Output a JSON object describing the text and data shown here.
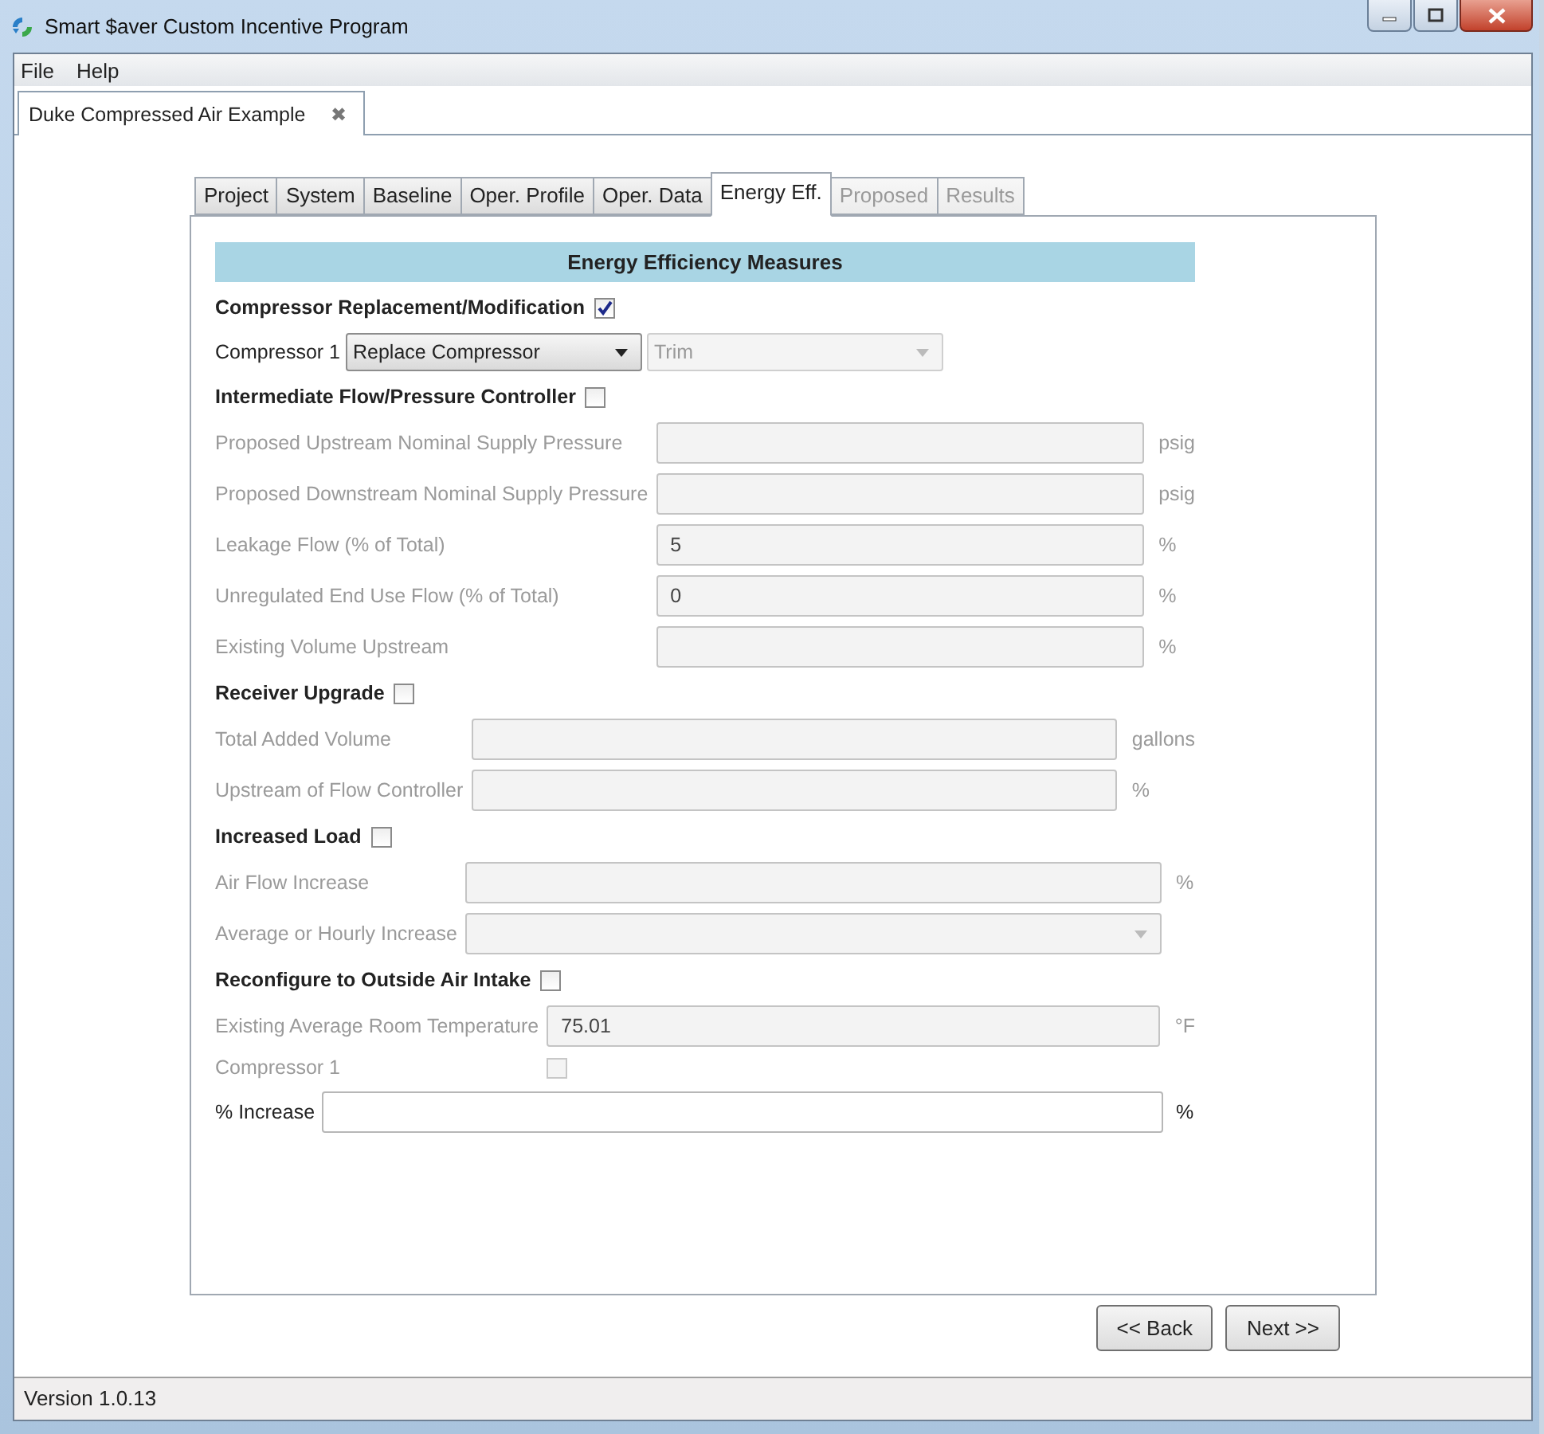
{
  "window": {
    "title": "Smart $aver Custom Incentive Program"
  },
  "menu": [
    "File",
    "Help"
  ],
  "document_tab": {
    "label": "Duke Compressed Air Example",
    "close": "✖"
  },
  "tabs": [
    {
      "label": "Project",
      "selected": false,
      "disabled": false
    },
    {
      "label": "System",
      "selected": false,
      "disabled": false
    },
    {
      "label": "Baseline",
      "selected": false,
      "disabled": false
    },
    {
      "label": "Oper. Profile",
      "selected": false,
      "disabled": false
    },
    {
      "label": "Oper. Data",
      "selected": false,
      "disabled": false
    },
    {
      "label": "Energy Eff.",
      "selected": true,
      "disabled": false
    },
    {
      "label": "Proposed",
      "selected": false,
      "disabled": true
    },
    {
      "label": "Results",
      "selected": false,
      "disabled": true
    }
  ],
  "section_title": "Energy Efficiency Measures",
  "groups": [
    {
      "label": "Compressor Replacement/Modification",
      "checked": true,
      "rows": [
        {
          "kind": "selects",
          "label": "Compressor 1",
          "selects": [
            {
              "value": "Replace Compressor",
              "disabled": false
            },
            {
              "value": "Trim",
              "disabled": true
            }
          ]
        }
      ]
    },
    {
      "label": "Intermediate Flow/Pressure Controller",
      "checked": false,
      "rows": [
        {
          "kind": "field",
          "label": "Proposed Upstream Nominal Supply Pressure",
          "unit": "psig",
          "disabled": true
        },
        {
          "kind": "field",
          "label": "Proposed Downstream Nominal Supply Pressure",
          "unit": "psig",
          "disabled": true
        },
        {
          "kind": "field",
          "label": "Leakage Flow (% of Total)",
          "value": "5",
          "unit": "%",
          "disabled": true
        },
        {
          "kind": "field",
          "label": "Unregulated End Use Flow (% of Total)",
          "value": "0",
          "unit": "%",
          "disabled": true
        },
        {
          "kind": "field",
          "label": "Existing Volume Upstream",
          "unit": "%",
          "disabled": true
        }
      ]
    },
    {
      "label": "Receiver Upgrade",
      "checked": false,
      "rows": [
        {
          "kind": "field",
          "label": "Total Added Volume",
          "unit": "gallons",
          "disabled": true
        },
        {
          "kind": "field",
          "label": "Upstream of Flow Controller",
          "unit": "%",
          "disabled": true
        }
      ]
    },
    {
      "label": "Increased Load",
      "checked": false,
      "rows": [
        {
          "kind": "field",
          "label": "Air Flow Increase",
          "unit": "%",
          "disabled": true
        },
        {
          "kind": "dropdown",
          "label": "Average or Hourly Increase",
          "disabled": true
        }
      ]
    },
    {
      "label": "Reconfigure to Outside Air Intake",
      "checked": false,
      "rows": [
        {
          "kind": "field",
          "label": "Existing Average Room Temperature",
          "value": "75.01",
          "unit": "°F",
          "disabled": true
        },
        {
          "kind": "checkbox",
          "label": "Compressor 1",
          "checked": false,
          "disabled": true
        },
        {
          "kind": "wide_field",
          "label": "% Increase",
          "unit": "%",
          "disabled": false
        }
      ]
    }
  ],
  "buttons": [
    "<< Back",
    "Next >>"
  ],
  "status_bar": "Version 1.0.13"
}
